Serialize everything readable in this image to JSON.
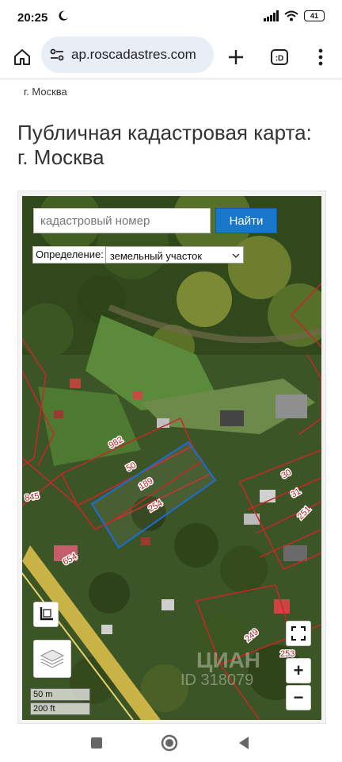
{
  "status": {
    "time": "20:25",
    "battery": "41"
  },
  "browser": {
    "url": "ap.roscadastres.com"
  },
  "page": {
    "breadcrumb": "г. Москва",
    "title": "Публичная кадастровая карта: г. Москва"
  },
  "map": {
    "search_placeholder": "кадастровый номер",
    "search_button": "Найти",
    "definition_label": "Определение:",
    "definition_value": "земельный участок",
    "zoom_in": "+",
    "zoom_out": "−",
    "scale_m": "50 m",
    "scale_ft": "200 ft",
    "watermark": "ЦИАН",
    "watermark_id": "ID 318079",
    "parcel_labels": [
      "982",
      "50",
      "189",
      "254",
      "845",
      "654",
      "30",
      "31",
      "251",
      "249",
      "253"
    ],
    "colors": {
      "parcel_border": "#c62828",
      "selected_parcel": "#1e6bd6",
      "button_blue": "#1978cc"
    }
  }
}
